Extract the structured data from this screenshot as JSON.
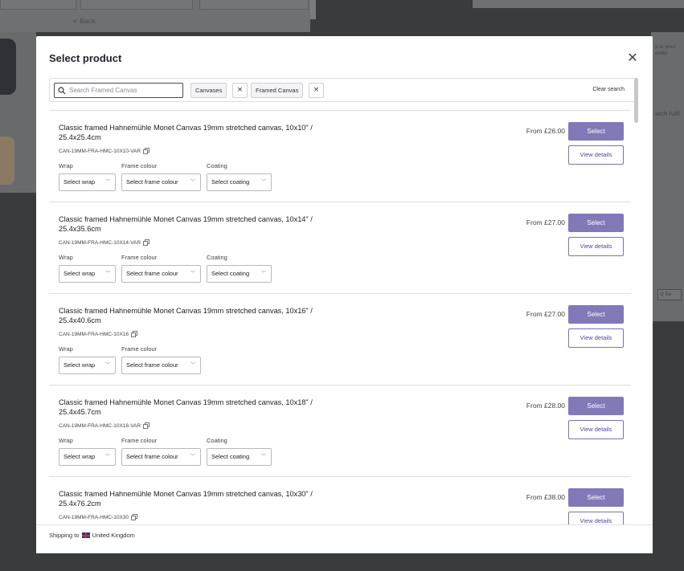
{
  "background": {
    "back_link": "< Back",
    "right_snippet_1": "s in your order",
    "right_snippet_2": "arch fulfi",
    "right_box": "Q Se"
  },
  "modal": {
    "title": "Select product",
    "close_icon": "close-icon"
  },
  "search": {
    "placeholder": "Search Framed Canvas",
    "value": "",
    "chips": [
      {
        "label": "Canvases"
      },
      {
        "label": "Framed Canvas"
      }
    ],
    "clear_label": "Clear search"
  },
  "labels": {
    "wrap": "Wrap",
    "frame_colour": "Frame colour",
    "coating": "Coating",
    "select_wrap": "Select wrap",
    "select_frame_colour": "Select frame colour",
    "select_coating": "Select coating",
    "select_button": "Select",
    "view_details": "View details"
  },
  "products": [
    {
      "title": "Classic framed Hahnemühle Monet Canvas 19mm stretched canvas, 10x10\" / 25.4x25.4cm",
      "sku": "CAN-19MM-FRA-HMC-10X10-VAR",
      "price": "From £26.00",
      "has_coating": true
    },
    {
      "title": "Classic framed Hahnemühle Monet Canvas 19mm stretched canvas, 10x14\" / 25.4x35.6cm",
      "sku": "CAN-19MM-FRA-HMC-10X14-VAR",
      "price": "From £27.00",
      "has_coating": true
    },
    {
      "title": "Classic framed Hahnemühle Monet Canvas 19mm stretched canvas, 10x16\" / 25.4x40.6cm",
      "sku": "CAN-19MM-FRA-HMC-10X16",
      "price": "From £27.00",
      "has_coating": false
    },
    {
      "title": "Classic framed Hahnemühle Monet Canvas 19mm stretched canvas, 10x18\" / 25.4x45.7cm",
      "sku": "CAN-19MM-FRA-HMC-10X18-VAR",
      "price": "From £28.00",
      "has_coating": true
    },
    {
      "title": "Classic framed Hahnemühle Monet Canvas 19mm stretched canvas, 10x30\" / 25.4x76.2cm",
      "sku": "CAN-19MM-FRA-HMC-10X30",
      "price": "From £38.00",
      "has_coating": false
    }
  ],
  "footer": {
    "shipping_prefix": "Shipping to",
    "flag_icon": "uk-flag-icon",
    "country": "United Kingdom"
  },
  "colors": {
    "accent": "#8279b8",
    "overlay": "#3a3b3c"
  }
}
